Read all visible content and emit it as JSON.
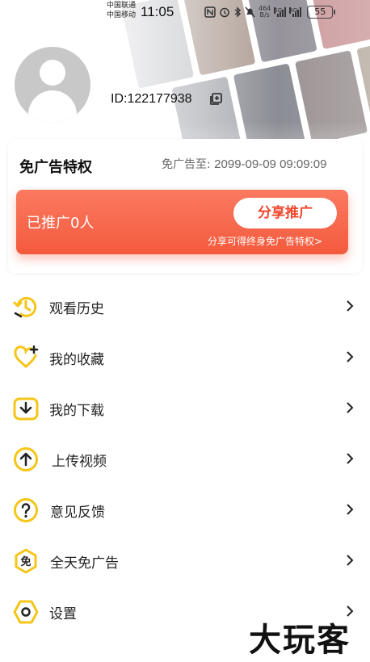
{
  "status_bar": {
    "carrier_1": "中国联通",
    "carrier_2": "中国移动",
    "time": "11:05",
    "net_speed_value": "464",
    "net_speed_unit": "B/s",
    "signal_1_tag": "5G",
    "signal_2_tag": "4G",
    "battery": "55"
  },
  "profile": {
    "id_text": "ID:122177938"
  },
  "privilege_card": {
    "title": "免广告特权",
    "expire_label": "免广告至:",
    "expire_value": "2099-09-09 09:09:09",
    "promoted_count": "已推广0人",
    "share_button": "分享推广",
    "share_tip": "分享可得终身免广告特权>"
  },
  "menu": [
    {
      "label": "观看历史",
      "icon": "history-icon"
    },
    {
      "label": "我的收藏",
      "icon": "favorite-heart-icon"
    },
    {
      "label": "我的下载",
      "icon": "download-icon"
    },
    {
      "label": "上传视频",
      "icon": "upload-icon"
    },
    {
      "label": "意见反馈",
      "icon": "feedback-question-icon"
    },
    {
      "label": "全天免广告",
      "icon": "no-ads-icon"
    },
    {
      "label": "设置",
      "icon": "settings-icon"
    }
  ],
  "watermark": "大玩客",
  "colors": {
    "accent_yellow": "#f5c518",
    "promo_red": "#f45a3d",
    "share_text_red": "#f0472c"
  }
}
